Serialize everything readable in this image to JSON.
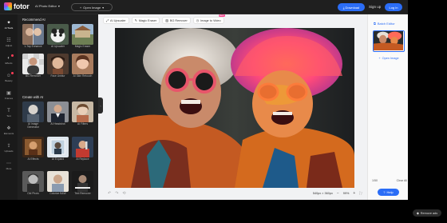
{
  "header": {
    "logo_text": "fotor",
    "editor_label": "AI Photo Editor",
    "open_image": "Open Image",
    "download": "Download",
    "signup": "Sign up",
    "login": "Log in"
  },
  "rail": [
    {
      "label": "AI Tools",
      "icon": "sparkle-icon",
      "active": true
    },
    {
      "label": "Adjust",
      "icon": "adjust-icon"
    },
    {
      "label": "Effects",
      "icon": "effects-icon"
    },
    {
      "label": "Beauty",
      "icon": "beauty-icon"
    },
    {
      "label": "Frames",
      "icon": "frame-icon"
    },
    {
      "label": "Text",
      "icon": "text-icon"
    },
    {
      "label": "Elements",
      "icon": "elements-icon"
    },
    {
      "label": "Uploads",
      "icon": "upload-icon"
    },
    {
      "label": "More",
      "icon": "more-icon"
    }
  ],
  "panel": {
    "recommended_title": "Recommend AI",
    "recommended": [
      {
        "label": "1-Tap Enhance"
      },
      {
        "label": "AI Upscaler"
      },
      {
        "label": "Magic Eraser"
      },
      {
        "label": "BG Remover"
      },
      {
        "label": "Face Unblur"
      },
      {
        "label": "AI Skin Retouch"
      }
    ],
    "create_title": "Create with AI",
    "create": [
      {
        "label": "AI Image Generator"
      },
      {
        "label": "AI Headshot"
      },
      {
        "label": "AI Filters"
      },
      {
        "label": "AI Effects"
      },
      {
        "label": "AI Expand"
      },
      {
        "label": "AI Replace"
      },
      {
        "label": "Old Photo"
      },
      {
        "label": "Colorize B&W"
      },
      {
        "label": "Text Remover"
      }
    ]
  },
  "toolbar": {
    "upscaler": "AI Upscaler",
    "eraser": "Magic Eraser",
    "bg_remover": "BG Remover",
    "image_to_video": "Image to Video",
    "new_badge": "NEW"
  },
  "canvas": {
    "dimensions": "540px × 360px",
    "zoom": "99%"
  },
  "right_panel": {
    "batch": "Batch Editor",
    "open_image": "Open Image",
    "page_count": "1/50",
    "clear_all": "Clear All",
    "help": "Help"
  },
  "ads": {
    "remove": "Remove ads"
  },
  "colors": {
    "accent": "#2b6df6",
    "app_bg": "#1e1e1e",
    "canvas_bg": "#f1f2f4"
  }
}
